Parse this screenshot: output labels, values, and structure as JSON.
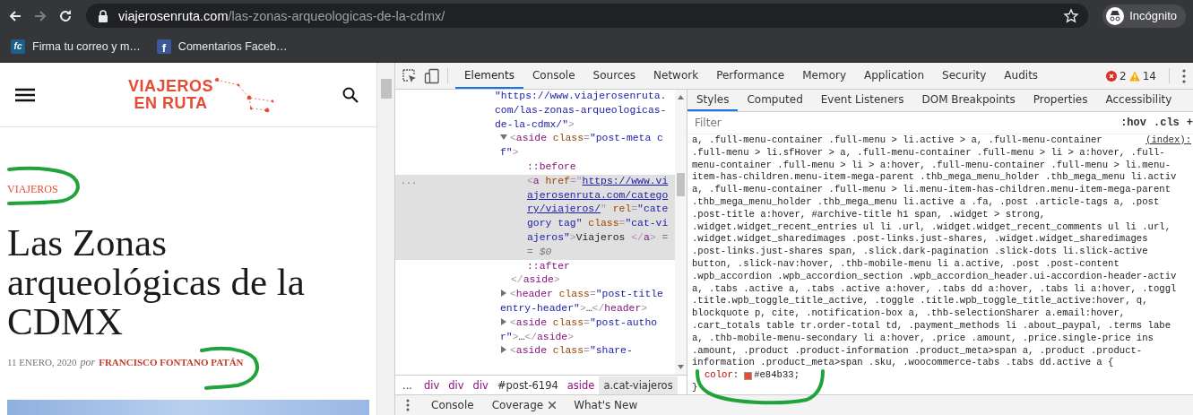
{
  "browser": {
    "url_host": "viajerosenruta.com",
    "url_path": "/las-zonas-arqueologicas-de-la-cdmx/",
    "profile_label": "Incógnito"
  },
  "bookmarks": [
    {
      "kind": "fc",
      "icon_text": "fc",
      "label": "Firma tu correo y m…"
    },
    {
      "kind": "facebook",
      "icon_text": "f",
      "label": "Comentarios Faceb…"
    }
  ],
  "site": {
    "logo": [
      "VIAJEROS",
      "EN RUTA"
    ],
    "category": "VIAJEROS",
    "title": "Las Zonas arqueológicas de la CDMX",
    "date": "11 ENERO, 2020",
    "by": "por",
    "author": "FRANCISCO FONTANO PATÁN"
  },
  "devtools": {
    "tabs": [
      {
        "label": "Elements",
        "selected": true
      },
      {
        "label": "Console",
        "selected": false
      },
      {
        "label": "Sources",
        "selected": false
      },
      {
        "label": "Network",
        "selected": false
      },
      {
        "label": "Performance",
        "selected": false
      },
      {
        "label": "Memory",
        "selected": false
      },
      {
        "label": "Application",
        "selected": false
      },
      {
        "label": "Security",
        "selected": false
      },
      {
        "label": "Audits",
        "selected": false
      }
    ],
    "errors": "2",
    "warnings": "14",
    "tree": {
      "selected": false,
      "tokens": [
        {
          "kind": "value",
          "text": "\"https://www.viajerosenruta.com/las-zonas-arqueologicas-de-la-cdmx/\""
        },
        {
          "kind": "punct",
          "text": ">"
        }
      ],
      "children": [
        {
          "selected": false,
          "expanded": true,
          "tokens": [
            {
              "kind": "punct",
              "text": "<"
            },
            {
              "kind": "tag",
              "text": "aside"
            },
            {
              "kind": "attr",
              "text": " class"
            },
            {
              "kind": "punct",
              "text": "="
            },
            {
              "kind": "value",
              "text": "\"post-meta cf\""
            },
            {
              "kind": "punct",
              "text": ">"
            }
          ],
          "children": [
            {
              "selected": false,
              "tokens": [
                {
                  "kind": "pseudo",
                  "text": "::before"
                }
              ]
            },
            {
              "selected": true,
              "gutter": "...",
              "tokens": [
                {
                  "kind": "punct",
                  "text": "<"
                },
                {
                  "kind": "tag",
                  "text": "a"
                },
                {
                  "kind": "attr",
                  "text": " href"
                },
                {
                  "kind": "punct",
                  "text": "=\""
                },
                {
                  "kind": "link",
                  "text": "https://www.viajerosenruta.com/category/viajeros/"
                },
                {
                  "kind": "punct",
                  "text": "\""
                },
                {
                  "kind": "attr",
                  "text": " rel"
                },
                {
                  "kind": "punct",
                  "text": "="
                },
                {
                  "kind": "value",
                  "text": "\"category tag\""
                },
                {
                  "kind": "attr",
                  "text": " class"
                },
                {
                  "kind": "punct",
                  "text": "="
                },
                {
                  "kind": "value",
                  "text": "\"cat-viajeros\""
                },
                {
                  "kind": "punct",
                  "text": ">"
                },
                {
                  "kind": "text",
                  "text": "Viajeros"
                },
                {
                  "kind": "punct",
                  "text": " </"
                },
                {
                  "kind": "tag",
                  "text": "a"
                },
                {
                  "kind": "punct",
                  "text": ">"
                },
                {
                  "kind": "dollar",
                  "text": " == $0"
                }
              ]
            },
            {
              "selected": false,
              "tokens": [
                {
                  "kind": "pseudo",
                  "text": "::after"
                }
              ]
            }
          ],
          "close_tokens": [
            {
              "kind": "punct",
              "text": "</"
            },
            {
              "kind": "tag",
              "text": "aside"
            },
            {
              "kind": "punct",
              "text": ">"
            }
          ]
        },
        {
          "selected": false,
          "expanded": false,
          "tokens": [
            {
              "kind": "punct",
              "text": "<"
            },
            {
              "kind": "tag",
              "text": "header"
            },
            {
              "kind": "attr",
              "text": " class"
            },
            {
              "kind": "punct",
              "text": "="
            },
            {
              "kind": "value",
              "text": "\"post-title entry-header\""
            },
            {
              "kind": "punct",
              "text": ">"
            },
            {
              "kind": "text",
              "text": "…"
            },
            {
              "kind": "punct",
              "text": "</"
            },
            {
              "kind": "tag",
              "text": "header"
            },
            {
              "kind": "punct",
              "text": ">"
            }
          ]
        },
        {
          "selected": false,
          "expanded": false,
          "tokens": [
            {
              "kind": "punct",
              "text": "<"
            },
            {
              "kind": "tag",
              "text": "aside"
            },
            {
              "kind": "attr",
              "text": " class"
            },
            {
              "kind": "punct",
              "text": "="
            },
            {
              "kind": "value",
              "text": "\"post-author\""
            },
            {
              "kind": "punct",
              "text": ">"
            },
            {
              "kind": "text",
              "text": "…"
            },
            {
              "kind": "punct",
              "text": "</"
            },
            {
              "kind": "tag",
              "text": "aside"
            },
            {
              "kind": "punct",
              "text": ">"
            }
          ]
        },
        {
          "selected": false,
          "expanded": false,
          "tokens": [
            {
              "kind": "punct",
              "text": "<"
            },
            {
              "kind": "tag",
              "text": "aside"
            },
            {
              "kind": "attr",
              "text": " class"
            },
            {
              "kind": "punct",
              "text": "="
            },
            {
              "kind": "value",
              "text": "\"share-"
            }
          ]
        }
      ]
    },
    "breadcrumbs": {
      "overflow": "...",
      "items": [
        {
          "label": "div",
          "kind": "tag",
          "selected": false
        },
        {
          "label": "div",
          "kind": "tag",
          "selected": false
        },
        {
          "label": "div",
          "kind": "tag",
          "selected": false
        },
        {
          "label": "#post-6194",
          "kind": "id",
          "selected": false
        },
        {
          "label": "aside",
          "kind": "tag",
          "selected": false
        },
        {
          "label": "a.cat-viajeros",
          "kind": "class",
          "selected": true
        }
      ]
    },
    "sidebar_tabs": [
      {
        "label": "Styles",
        "selected": true
      },
      {
        "label": "Computed",
        "selected": false
      },
      {
        "label": "Event Listeners",
        "selected": false
      },
      {
        "label": "DOM Breakpoints",
        "selected": false
      },
      {
        "label": "Properties",
        "selected": false
      },
      {
        "label": "Accessibility",
        "selected": false
      }
    ],
    "filter": {
      "placeholder": "Filter"
    },
    "filter_buttons": [
      ":hov",
      ".cls",
      "+"
    ],
    "rule": {
      "source": "(index):",
      "selector_lines": [
        "a, .full-menu-container .full-menu > li.active > a, .full-menu-container",
        ".full-menu > li.sfHover > a, .full-menu-container .full-menu > li > a:hover, .full-",
        "menu-container .full-menu > li > a:hover, .full-menu-container .full-menu > li.menu-",
        "item-has-children.menu-item-mega-parent .thb_mega_menu_holder .thb_mega_menu li.activ",
        "a, .full-menu-container .full-menu > li.menu-item-has-children.menu-item-mega-parent",
        ".thb_mega_menu_holder .thb_mega_menu li.active a .fa, .post .article-tags a, .post",
        ".post-title a:hover, #archive-title h1 span, .widget > strong,",
        ".widget.widget_recent_entries ul li .url, .widget.widget_recent_comments ul li .url,",
        ".widget.widget_sharedimages .post-links.just-shares, .widget.widget_sharedimages",
        ".post-links.just-shares span, .slick.dark-pagination .slick-dots li.slick-active",
        "button, .slick-nav:hover, .thb-mobile-menu li a.active, .post .post-content",
        ".wpb_accordion .wpb_accordion_section .wpb_accordion_header.ui-accordion-header-activ",
        "a, .tabs .active a, .tabs .active a:hover, .tabs dd a:hover, .tabs li a:hover, .toggl",
        ".title.wpb_toggle_title_active, .toggle .title.wpb_toggle_title_active:hover, q,",
        "blockquote p, cite, .notification-box a, .thb-selectionSharer a.email:hover,",
        ".cart_totals table tr.order-total td, .payment_methods li .about_paypal, .terms labe",
        "a, .thb-mobile-menu-secondary li a:hover, .price .amount, .price.single-price ins",
        ".amount, .product .product-information .product_meta>span a, .product .product-",
        "information .product_meta>span .sku, .woocommerce-tabs .tabs dd.active a {"
      ],
      "properties": [
        {
          "name": "color",
          "separator": ":",
          "value": "#e84b33",
          "terminator": ";",
          "color": "#e84b33"
        }
      ],
      "close": "}"
    },
    "drawer_tabs": [
      {
        "label": "Console",
        "closable": false
      },
      {
        "label": "Coverage",
        "closable": true
      },
      {
        "label": "What's New",
        "closable": false
      }
    ]
  }
}
